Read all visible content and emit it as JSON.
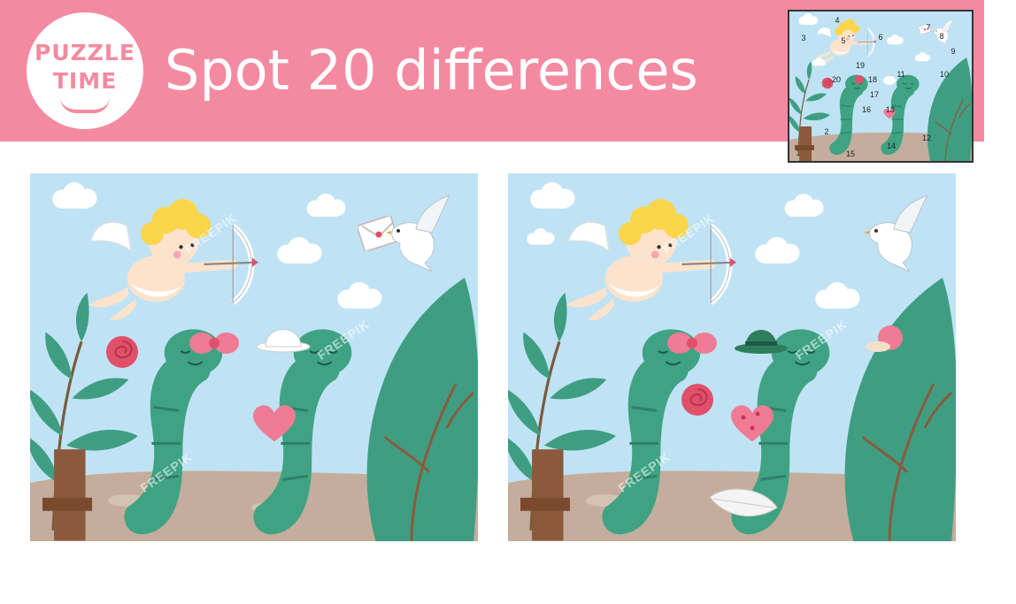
{
  "header": {
    "logo_line1": "PUZZLE",
    "logo_line2": "TIME",
    "title": "Spot 20 differences"
  },
  "answer_key": {
    "markers": [
      "1",
      "2",
      "3",
      "4",
      "5",
      "6",
      "7",
      "8",
      "9",
      "10",
      "11",
      "12",
      "13",
      "14",
      "15",
      "16",
      "17",
      "18",
      "19",
      "20"
    ]
  },
  "watermark": "FREEPIK",
  "colors": {
    "banner": "#f48aa0",
    "sky": "#bfe3f5",
    "ground": "#c4ad9c",
    "caterpillar": "#3fa383",
    "bush": "#3f9e82"
  },
  "icons": {
    "cupid": "cupid-icon",
    "dove": "dove-icon",
    "envelope": "envelope-icon",
    "heart": "heart-icon",
    "rose": "rose-icon",
    "bow": "bow-icon",
    "hat": "hat-icon",
    "leaf": "leaf-icon",
    "snail": "snail-icon"
  }
}
